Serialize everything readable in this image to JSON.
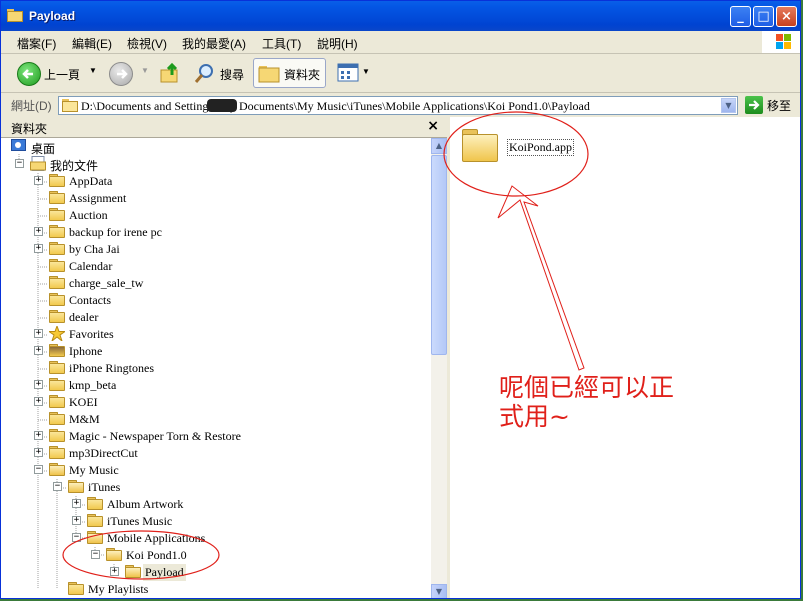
{
  "window": {
    "title": "Payload"
  },
  "menu": [
    "檔案(F)",
    "編輯(E)",
    "檢視(V)",
    "我的最愛(A)",
    "工具(T)",
    "說明(H)"
  ],
  "toolbar": {
    "back_label": "上一頁",
    "search_label": "搜尋",
    "folders_label": "資料夾"
  },
  "address": {
    "label": "網址(D)",
    "path": "D:\\Documents and Settings\\      My Documents\\My Music\\iTunes\\Mobile Applications\\Koi Pond1.0\\Payload",
    "go_label": "移至"
  },
  "folder_pane": {
    "title": "資料夾",
    "close": "×"
  },
  "tree": [
    "桌面",
    "我的文件",
    "AppData",
    "Assignment",
    "Auction",
    "backup for irene pc",
    "by Cha Jai",
    "Calendar",
    "charge_sale_tw",
    "Contacts",
    "dealer",
    "Favorites",
    "Iphone",
    "iPhone Ringtones",
    "kmp_beta",
    "KOEI",
    "M&M",
    "Magic - Newspaper Torn & Restore",
    "mp3DirectCut",
    "My Music",
    "iTunes",
    "Album Artwork",
    "iTunes Music",
    "Mobile Applications",
    "Koi Pond1.0",
    "Payload",
    "My Playlists"
  ],
  "content": {
    "item_label": "KoiPond.app"
  },
  "annotation": {
    "line1": "呢個已經可以正",
    "line2": "式用~"
  },
  "colors": {
    "titlebar": "#0456e4",
    "annotation": "#e0201a"
  }
}
